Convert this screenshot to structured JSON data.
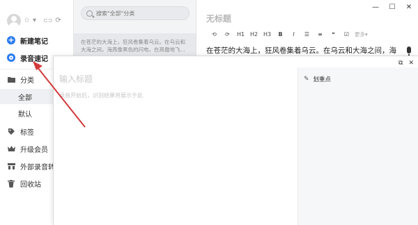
{
  "sidebar": {
    "user": {
      "star_icon": "☆",
      "dropdown_icon": "▾",
      "sync_icon": "⟳",
      "link_icon": "⊂⊃"
    },
    "new_note": "新建笔记",
    "voice_note": "录音速记",
    "category": "分类",
    "sub_items": [
      "全部",
      "默认"
    ],
    "tags": "标签",
    "upgrade": "升级会员",
    "external_audio": "外部录音转写",
    "recycle": "回收站"
  },
  "list": {
    "search_placeholder": "搜索\"全部\"分类",
    "note_snippet": "在苍茫的大海上，狂风卷集着乌云。在乌云和大海之间，海燕像黑色的闪电，在高傲地飞..."
  },
  "editor": {
    "title": "无标题",
    "toolbar": [
      "⟲",
      "⟳",
      "H1",
      "H2",
      "H3",
      "B",
      "I",
      "☰",
      "≡",
      "❝",
      "☑",
      "更多▾"
    ],
    "content": "在苍茫的大海上，狂风卷集着乌云。在乌云和大海之间，海",
    "window_controls": [
      "—",
      "☐",
      "✕"
    ]
  },
  "popup": {
    "title_placeholder": "输入标题",
    "hint": "录音开始后，识别结果将展示于此",
    "highlight_label": "划重点",
    "window_controls": [
      "⧉",
      "✕"
    ]
  },
  "colors": {
    "accent": "#2b7bf0",
    "arrow": "#d23a3a"
  }
}
